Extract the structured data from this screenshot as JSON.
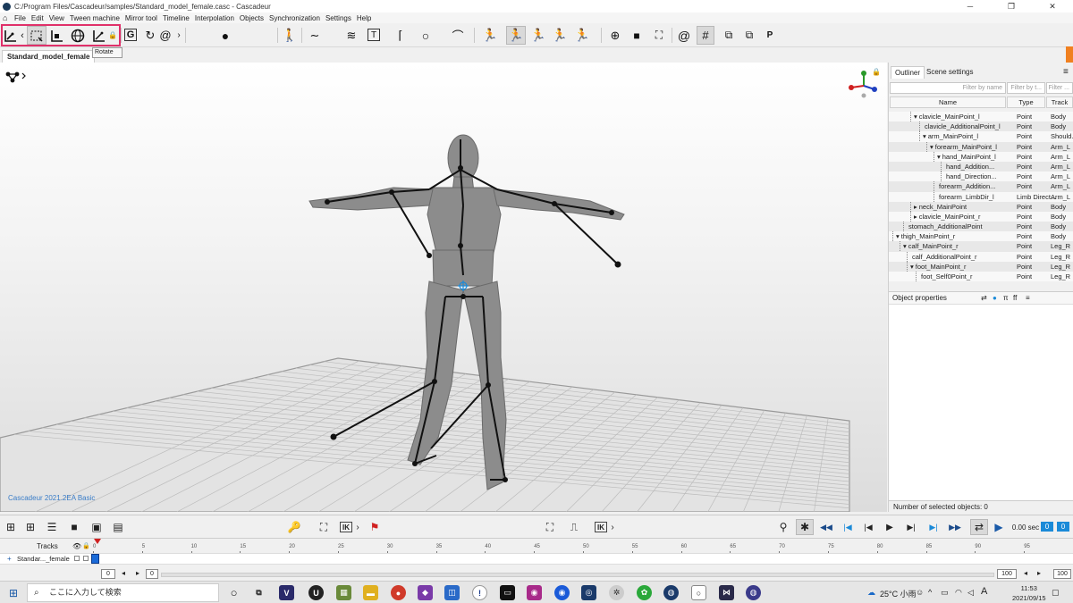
{
  "window": {
    "title": "C:/Program Files/Cascadeur/samples/Standard_model_female.casc - Cascadeur",
    "minimize": "─",
    "maximize": "❐",
    "close": "✕"
  },
  "menu": [
    "File",
    "Edit",
    "View",
    "Tween machine",
    "Mirror tool",
    "Timeline",
    "Interpolation",
    "Objects",
    "Synchronization",
    "Settings",
    "Help"
  ],
  "toolbar": {
    "g_label": "G",
    "num_box_1": "0",
    "num_box_2": "0",
    "t_label": "T",
    "p_label": "P"
  },
  "tooltip": "Rotate",
  "scene_tab": {
    "label": "Standard_model_female",
    "close": "×"
  },
  "watermark": "Cascadeur 2021.2EA Basic",
  "panel": {
    "tab_outliner": "Outliner",
    "tab_scene": "Scene settings",
    "menu_icon": "≡",
    "filter_name": "Filter by name",
    "filter_type": "Filter by t...",
    "filter_track": "Filter ...",
    "col_name": "Name",
    "col_type": "Type",
    "col_track": "Track",
    "rows": [
      {
        "name": "clavicle_MainPoint_l",
        "expander": "▾",
        "type": "Point",
        "track": "Body"
      },
      {
        "name": "clavicle_AdditionalPoint_l",
        "expander": "",
        "type": "Point",
        "track": "Body"
      },
      {
        "name": "arm_MainPoint_l",
        "expander": "▾",
        "type": "Point",
        "track": "Should..."
      },
      {
        "name": "forearm_MainPoint_l",
        "expander": "▾",
        "type": "Point",
        "track": "Arm_L"
      },
      {
        "name": "hand_MainPoint_l",
        "expander": "▾",
        "type": "Point",
        "track": "Arm_L"
      },
      {
        "name": "hand_Addition...",
        "expander": "",
        "type": "Point",
        "track": "Arm_L"
      },
      {
        "name": "hand_Direction...",
        "expander": "",
        "type": "Point",
        "track": "Arm_L"
      },
      {
        "name": "forearm_Addition...",
        "expander": "",
        "type": "Point",
        "track": "Arm_L"
      },
      {
        "name": "forearm_LimbDir_l",
        "expander": "",
        "type": "Limb Direct...",
        "track": "Arm_L"
      },
      {
        "name": "neck_MainPoint",
        "expander": "▸",
        "type": "Point",
        "track": "Body"
      },
      {
        "name": "clavicle_MainPoint_r",
        "expander": "▸",
        "type": "Point",
        "track": "Body"
      },
      {
        "name": "stomach_AdditionalPoint",
        "expander": "",
        "type": "Point",
        "track": "Body"
      },
      {
        "name": "thigh_MainPoint_r",
        "expander": "▾",
        "type": "Point",
        "track": "Body"
      },
      {
        "name": "calf_MainPoint_r",
        "expander": "▾",
        "type": "Point",
        "track": "Leg_R"
      },
      {
        "name": "calf_AdditionalPoint_r",
        "expander": "",
        "type": "Point",
        "track": "Leg_R"
      },
      {
        "name": "foot_MainPoint_r",
        "expander": "▾",
        "type": "Point",
        "track": "Leg_R"
      },
      {
        "name": "foot_Self0Point_r",
        "expander": "",
        "type": "Point",
        "track": "Leg_R"
      }
    ],
    "object_properties": "Object properties",
    "prop_icons": {
      "pi": "π",
      "ff": "ff",
      "menu": "≡"
    },
    "selected_count": "Number of selected objects: 0"
  },
  "bottom": {
    "time": "0.00 sec",
    "frame_a": "0",
    "frame_b": "0",
    "ik_1": "IK",
    "ik_2": "IK",
    "ik_3": "IK"
  },
  "timeline": {
    "tracks_label": "Tracks",
    "track_name": "Standar..._female",
    "ticks": [
      "0",
      "5",
      "10",
      "15",
      "20",
      "25",
      "30",
      "35",
      "40",
      "45",
      "50",
      "55",
      "60",
      "65",
      "70",
      "75",
      "80",
      "85",
      "90",
      "95"
    ],
    "start": "0",
    "current": "0",
    "end": "100",
    "end2": "100"
  },
  "taskbar": {
    "search": "ここに入力して検索",
    "temp": "25°C 小雨",
    "ime": "A",
    "time": "11:53",
    "date": "2021/09/15"
  },
  "colors": {
    "highlight": "#e0306a",
    "accent": "#f08020",
    "selected_blue": "#1a8ad8"
  }
}
